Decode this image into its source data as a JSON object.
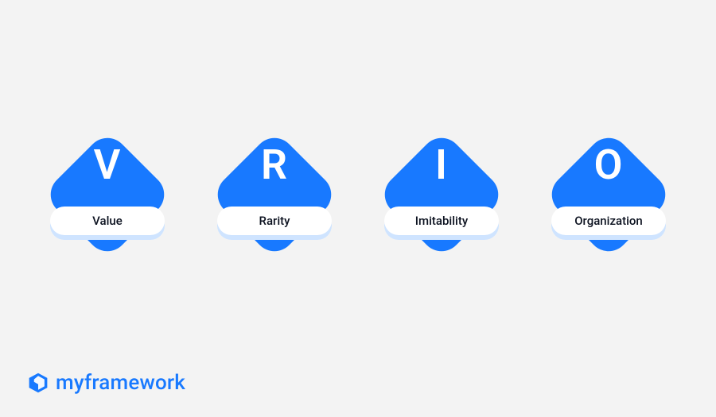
{
  "brand": {
    "name": "myframework"
  },
  "colors": {
    "accent": "#1879ff",
    "bg": "#f3f3f3",
    "pill": "#ffffff",
    "pillShadow": "#cfe4ff",
    "text": "#0c1220"
  },
  "items": [
    {
      "letter": "V",
      "label": "Value"
    },
    {
      "letter": "R",
      "label": "Rarity"
    },
    {
      "letter": "I",
      "label": "Imitability"
    },
    {
      "letter": "O",
      "label": "Organization"
    }
  ]
}
